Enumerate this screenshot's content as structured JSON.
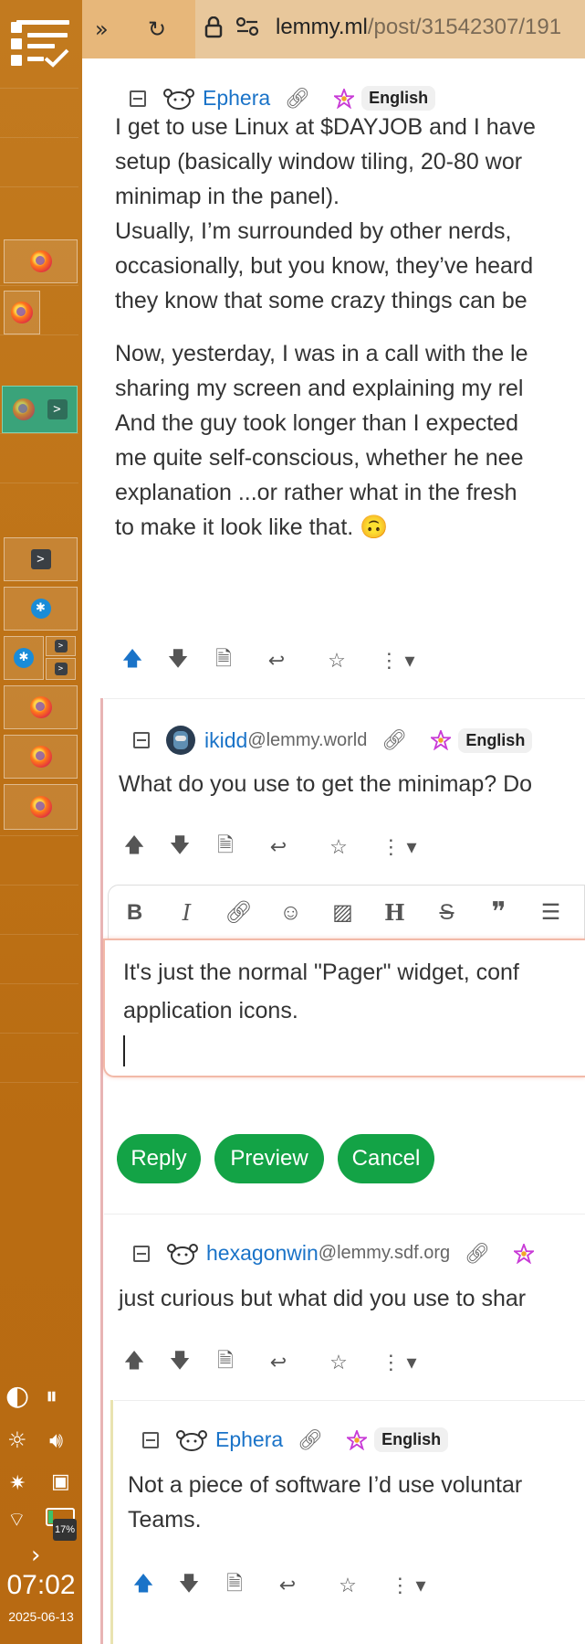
{
  "browser": {
    "url_host": "lemmy.ml",
    "url_path": "/post/31542307/191"
  },
  "taskbar": {
    "clock": "07:02",
    "date": "2025-06-13",
    "battery_level": "17%"
  },
  "comments": [
    {
      "user": "Ephera",
      "instance": "",
      "language": "English",
      "lines": [
        "I get to use Linux at $DAYJOB and I have",
        "setup (basically window tiling, 20-80 wor",
        "minimap in the panel).",
        "Usually, I’m surrounded by other nerds,",
        "occasionally, but you know, they’ve heard",
        "they know that some crazy things can be",
        "",
        "Now, yesterday, I was in a call with the le",
        "sharing my screen and explaining my rel",
        "And the guy took longer than I expected",
        "me quite self-conscious, whether he nee",
        "explanation ...or rather what in the fresh",
        "to make it look like that. 🙃"
      ]
    },
    {
      "user": "ikidd",
      "instance": "@lemmy.world",
      "language": "English",
      "lines": [
        "What do you use to get the minimap? Do"
      ]
    },
    {
      "user": "hexagonwin",
      "instance": "@lemmy.sdf.org",
      "language": "",
      "lines": [
        "just curious but what did you use to shar"
      ]
    },
    {
      "user": "Ephera",
      "instance": "",
      "language": "English",
      "lines": [
        "Not a piece of software I’d use voluntar",
        "Teams."
      ]
    }
  ],
  "editor": {
    "lines": [
      "It's just the normal \"Pager\" widget, conf",
      "application icons."
    ],
    "buttons": {
      "reply": "Reply",
      "preview": "Preview",
      "cancel": "Cancel"
    }
  },
  "colors": {
    "accent_link": "#1a73c8",
    "button_green": "#13a346",
    "dock": "#c27a1f",
    "thread_line_1": "#e8b4b4",
    "thread_line_2": "#e9e3b0"
  }
}
